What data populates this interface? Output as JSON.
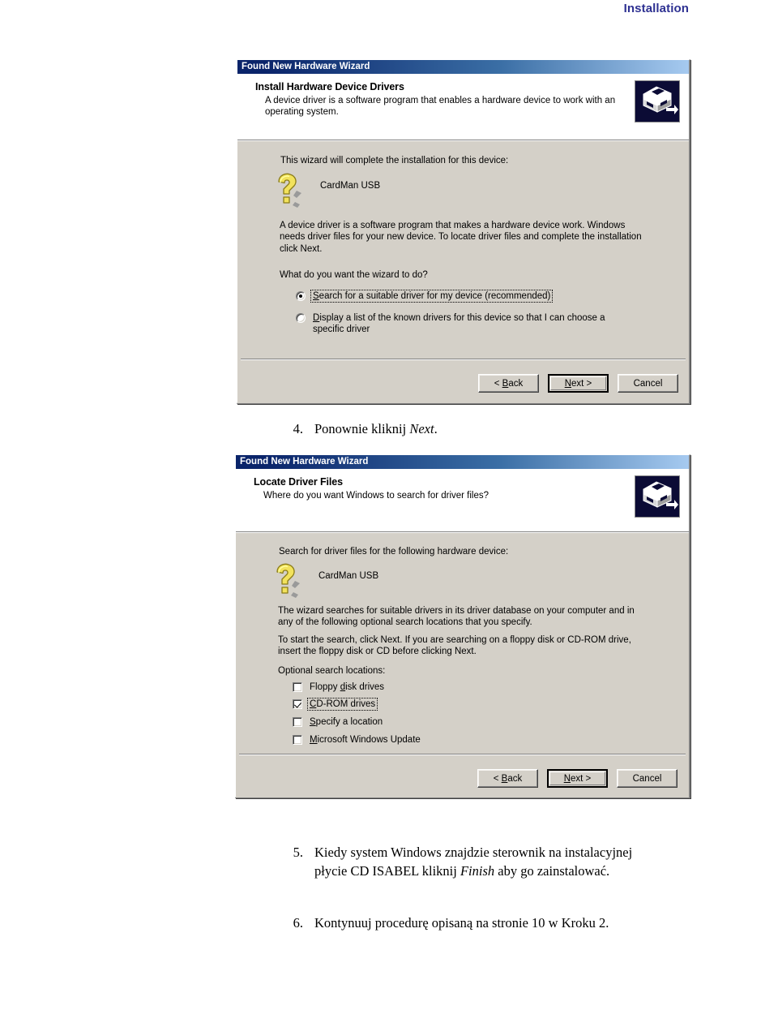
{
  "page": {
    "header_title": "Installation",
    "accent_color": "#2e3192"
  },
  "dialog1": {
    "titlebar": "Found New Hardware Wizard",
    "header_title": "Install Hardware Device Drivers",
    "header_sub": "A device driver is a software program that enables a hardware device to work with an operating system.",
    "intro": "This wizard will complete the installation for this device:",
    "device_name": "CardMan USB",
    "description": "A device driver is a software program that makes a hardware device work. Windows needs driver files for your new device. To locate driver files and complete the installation click Next.",
    "question": "What do you want the wizard to do?",
    "options": [
      {
        "label_pre": "",
        "accel": "S",
        "label_post": "earch for a suitable driver for my device (recommended)",
        "selected": true,
        "focused": true
      },
      {
        "label_pre": "",
        "accel": "D",
        "label_post": "isplay a list of the known drivers for this device so that I can choose a specific driver",
        "selected": false,
        "focused": false
      }
    ],
    "buttons": {
      "back_pre": "< ",
      "back_accel": "B",
      "back_post": "ack",
      "next_accel": "N",
      "next_post": "ext >",
      "cancel": "Cancel"
    },
    "icons": {
      "header": "hardware-device-icon",
      "device": "question-mark-icon"
    }
  },
  "step4": {
    "number": "4.",
    "text_pre": "Ponownie kliknij ",
    "text_italic": "Next",
    "text_post": "."
  },
  "dialog2": {
    "titlebar": "Found New Hardware Wizard",
    "header_title": "Locate Driver Files",
    "header_sub": "Where do you want Windows to search for driver files?",
    "intro": "Search for driver files for the following hardware device:",
    "device_name": "CardMan USB",
    "paragraph1": "The wizard searches for suitable drivers in its driver database on your computer and in any of the following optional search locations that you specify.",
    "paragraph2": "To start the search, click Next. If you are searching on a floppy disk or CD-ROM drive, insert the floppy disk or CD before clicking Next.",
    "optional_label": "Optional search locations:",
    "checkboxes": [
      {
        "label_pre": "Floppy ",
        "accel": "d",
        "label_post": "isk drives",
        "checked": false,
        "focused": false
      },
      {
        "label_pre": "",
        "accel": "C",
        "label_post": "D-ROM drives",
        "checked": true,
        "focused": true
      },
      {
        "label_pre": "",
        "accel": "S",
        "label_post": "pecify a location",
        "checked": false,
        "focused": false
      },
      {
        "label_pre": "",
        "accel": "M",
        "label_post": "icrosoft Windows Update",
        "checked": false,
        "focused": false
      }
    ],
    "buttons": {
      "back_pre": "< ",
      "back_accel": "B",
      "back_post": "ack",
      "next_accel": "N",
      "next_post": "ext >",
      "cancel": "Cancel"
    },
    "icons": {
      "header": "hardware-device-icon",
      "device": "question-mark-icon"
    }
  },
  "step5": {
    "number": "5.",
    "text_pre": "Kiedy system Windows znajdzie sterownik na instalacyjnej płycie CD ISABEL kliknij ",
    "text_italic": "Finish",
    "text_post": " aby go zainstalować."
  },
  "step6": {
    "number": "6.",
    "text": "Kontynuuj procedurę opisaną na stronie 10 w Kroku 2."
  }
}
